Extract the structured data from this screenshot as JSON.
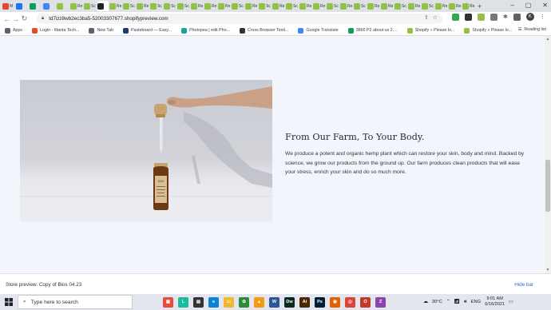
{
  "browser": {
    "tabs": [
      {
        "label": "M",
        "color": "#ea4335"
      },
      {
        "label": "",
        "color": "#1a73e8"
      },
      {
        "label": "",
        "color": "#0f9d58"
      },
      {
        "label": "",
        "color": "#4285f4"
      },
      {
        "label": "",
        "color": "#95bf47"
      },
      {
        "label": "Re",
        "color": "#95bf47"
      },
      {
        "label": "Sc",
        "color": "#95bf47"
      },
      {
        "label": "",
        "color": "#222222",
        "active": true
      },
      {
        "label": "Re",
        "color": "#95bf47"
      },
      {
        "label": "Sc",
        "color": "#95bf47"
      },
      {
        "label": "Re",
        "color": "#95bf47"
      },
      {
        "label": "Sc",
        "color": "#95bf47"
      },
      {
        "label": "Sc",
        "color": "#95bf47"
      },
      {
        "label": "Sc",
        "color": "#95bf47"
      },
      {
        "label": "Re",
        "color": "#95bf47"
      },
      {
        "label": "Re",
        "color": "#95bf47"
      },
      {
        "label": "Re",
        "color": "#95bf47"
      },
      {
        "label": "Sc",
        "color": "#95bf47"
      },
      {
        "label": "Re",
        "color": "#95bf47"
      },
      {
        "label": "Sc",
        "color": "#95bf47"
      },
      {
        "label": "Re",
        "color": "#95bf47"
      },
      {
        "label": "Sc",
        "color": "#95bf47"
      },
      {
        "label": "Re",
        "color": "#95bf47"
      },
      {
        "label": "Re",
        "color": "#95bf47"
      },
      {
        "label": "Sc",
        "color": "#95bf47"
      },
      {
        "label": "Re",
        "color": "#95bf47"
      },
      {
        "label": "Sc",
        "color": "#95bf47"
      },
      {
        "label": "Re",
        "color": "#95bf47"
      },
      {
        "label": "Re",
        "color": "#95bf47"
      },
      {
        "label": "Sc",
        "color": "#95bf47"
      },
      {
        "label": "Re",
        "color": "#95bf47"
      },
      {
        "label": "Sc",
        "color": "#95bf47"
      },
      {
        "label": "Re",
        "color": "#95bf47"
      },
      {
        "label": "Re",
        "color": "#95bf47"
      },
      {
        "label": "Re",
        "color": "#95bf47"
      }
    ],
    "url": "td7izz8wb2ec3ba5-52003307677.shopifypreview.com",
    "profile_initial": "K",
    "bookmarks": [
      {
        "label": "Apps",
        "color": "#5f6368"
      },
      {
        "label": "Login - Ittanta Tech...",
        "color": "#e44d26"
      },
      {
        "label": "New Tab",
        "color": "#5f6368"
      },
      {
        "label": "Pasteboard — Easy...",
        "color": "#1e3c72"
      },
      {
        "label": "Photopea | edit Pho...",
        "color": "#18a497"
      },
      {
        "label": "Cross Browser Testi...",
        "color": "#333333"
      },
      {
        "label": "Google Translate",
        "color": "#4285f4"
      },
      {
        "label": "3866 P2 about us 2....",
        "color": "#0f9d58"
      },
      {
        "label": "Shopify » Please lo...",
        "color": "#95bf47"
      },
      {
        "label": "Shopify » Please lo...",
        "color": "#95bf47"
      }
    ],
    "reading_list": "Reading list"
  },
  "page": {
    "heading": "From Our Farm, To Your Body.",
    "paragraph": "We produce a potent and organic hemp plant which can restore your skin, body and mind. Backed by science, we grow our products from the ground up. Our farm produces clean products that will ease your stress, enrich your skin and do so much more.",
    "bottle_label": "BIOS"
  },
  "preview_bar": {
    "label": "Store preview:",
    "store": "Copy of Bios 04.23",
    "hide": "Hide bar"
  },
  "taskbar": {
    "search_placeholder": "Type here to search",
    "weather": "30°C",
    "language": "ENG",
    "time": "9:01 AM",
    "date": "6/16/2021"
  }
}
